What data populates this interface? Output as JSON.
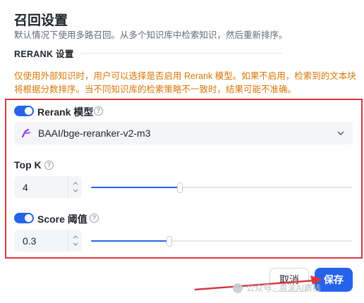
{
  "header": {
    "title": "召回设置",
    "subtitle": "默认情况下使用多路召回。从多个知识库中检索知识，然后重新排序。"
  },
  "section": {
    "label": "RERANK 设置"
  },
  "warning": {
    "text": "仅使用外部知识时，用户可以选择是否启用 Rerank 模型。如果不启用，检索到的文本块将根据分数排序。当不同知识库的检索策略不一致时，结果可能不准确。"
  },
  "rerank": {
    "enabled": true,
    "label": "Rerank 模型",
    "model_value": "BAAI/bge-reranker-v2-m3"
  },
  "top_k": {
    "label": "Top K",
    "value": "4",
    "slider_fraction": 0.34
  },
  "score": {
    "enabled": true,
    "label": "Score 阈值",
    "value": "0.3",
    "slider_fraction": 0.3
  },
  "footer": {
    "cancel_label": "取消",
    "save_label": "保存"
  },
  "watermark": {
    "text": "公众号 · 袁滚AI群栈"
  },
  "colors": {
    "accent": "#2563eb",
    "warning": "#d97706",
    "highlight_border": "#d9363e"
  },
  "icons": {
    "help": "question-circle-icon",
    "model": "model-logo-icon",
    "chevron": "chevron-down-icon"
  }
}
